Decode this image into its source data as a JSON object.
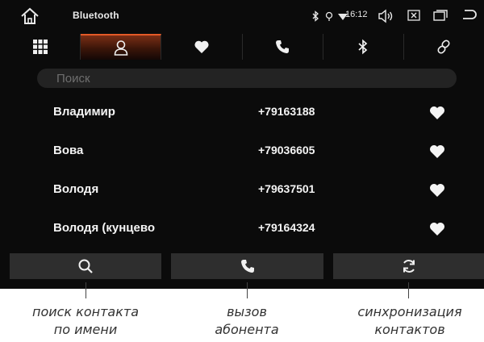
{
  "status_bar": {
    "title": "Bluetooth",
    "time": "16:12",
    "icons": [
      "home-icon",
      "bluetooth-icon",
      "location-icon",
      "wifi-icon",
      "volume-icon",
      "close-box-icon",
      "window-icon",
      "back-icon"
    ]
  },
  "tabs": [
    {
      "icon": "grid-icon",
      "active": false
    },
    {
      "icon": "contacts-icon",
      "active": true
    },
    {
      "icon": "heart-icon",
      "active": false
    },
    {
      "icon": "phone-icon",
      "active": false
    },
    {
      "icon": "bluetooth-icon",
      "active": false
    },
    {
      "icon": "link-icon",
      "active": false
    }
  ],
  "search": {
    "placeholder": "Поиск"
  },
  "contacts": [
    {
      "name": "Владимир",
      "phone": "+79163188"
    },
    {
      "name": "Вова",
      "phone": "+79036605"
    },
    {
      "name": "Володя",
      "phone": "+79637501"
    },
    {
      "name": "Володя (кунцево",
      "phone": "+79164324"
    }
  ],
  "bottom_buttons": [
    {
      "icon": "search-icon"
    },
    {
      "icon": "phone-icon"
    },
    {
      "icon": "sync-icon"
    }
  ],
  "captions": {
    "search": [
      "поиск контакта",
      "по имени"
    ],
    "call": [
      "вызов",
      "абонента"
    ],
    "sync": [
      "синхронизация",
      "контактов"
    ]
  },
  "colors": {
    "background": "#0b0b0b",
    "accent": "#e45a27",
    "active_tab": "#7a2e15",
    "button": "#2e2e2e",
    "text": "#f4f4f4"
  }
}
